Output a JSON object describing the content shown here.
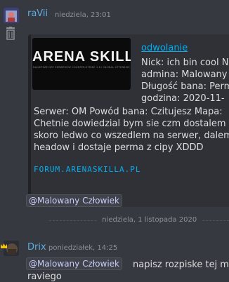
{
  "message1": {
    "author": "raVii",
    "timestamp": "niedziela, 23:01",
    "author_color": "#5dade2",
    "avatar_icon": "avatar-icon",
    "delete_icon": "trash-icon",
    "embed": {
      "image_logo_text": "ARENA SKILLA",
      "image_subtitle": "NAJLEPSZE GRY SERWERÓW COUNTER-STRIKE 1.6 I GŁOBAL OFFENSIVE",
      "title": "odwolanie",
      "lines": [
        "Nick: ich bin cool N",
        "admina: Malowany",
        "Długość bana: Perm",
        "godzina: 2020-11-",
        "Serwer: OM Powód bana: Czitujesz Mapa:",
        "Chetnie dowiedzial bym sie czm dostalem",
        "skoro ledwo co wszedlem na serwer, dalem",
        "headow i dostaje perma z cipy XDDD"
      ],
      "footer": "FORUM.ARENASKILLA.PL",
      "link_color": "#00b0f4"
    },
    "mention": "@Malowany Człowiek"
  },
  "date_divider": "niedziela, 1 listopada 2020",
  "message2": {
    "author": "Drix",
    "timestamp": "poniedziałek, 14:25",
    "author_color": "#5dade2",
    "avatar_icon": "avatar-icon",
    "crown_icon": "crown-icon",
    "mention": "@Malowany Człowiek",
    "text_line1": "napisz rozpiske tej m",
    "text_line2": "raviego"
  }
}
